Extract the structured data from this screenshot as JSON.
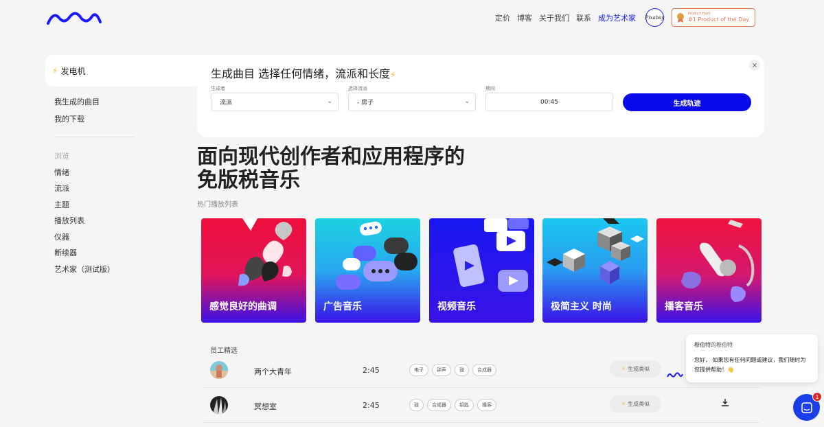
{
  "header": {
    "nav": [
      "定价",
      "博客",
      "关于我们",
      "联系",
      "成为艺术家"
    ],
    "badge_circle_text": "Pixabay",
    "product_hunt": {
      "small": "Product Hunt",
      "big": "#1 Product of the Day"
    }
  },
  "sidebar": {
    "generator_tab": "发电机",
    "links": [
      "我生成的曲目",
      "我的下载"
    ],
    "browse_heading": "浏览",
    "browse_items": [
      "情绪",
      "流派",
      "主题",
      "播放列表",
      "仪器",
      "断续器",
      "艺术家（测试版）"
    ]
  },
  "generator": {
    "title": "生成曲目 选择任何情绪，流派和长度",
    "close": "×",
    "genre_label": "生成者",
    "genre_value": "流派",
    "subgenre_label": "选择流派",
    "subgenre_value": "- 房子",
    "duration_label": "期间",
    "duration_value": "00:45",
    "button": "生成轨迹"
  },
  "hero": {
    "line1": "面向现代创作者和应用程序的",
    "line2": "免版税音乐",
    "playlist_heading": "热门播放列表"
  },
  "playlists": [
    {
      "label": "感觉良好的曲调"
    },
    {
      "label": "广告音乐"
    },
    {
      "label": "视频音乐"
    },
    {
      "label": "极简主义 时尚"
    },
    {
      "label": "播客音乐"
    }
  ],
  "staff": {
    "heading": "员工精选",
    "rows": [
      {
        "name": "两个大青年",
        "duration": "2:45",
        "tags": [
          "电子",
          "钟声",
          "鼓",
          "合成器"
        ],
        "similar": "生成类似"
      },
      {
        "name": "冥想室",
        "duration": "2:45",
        "tags": [
          "鼓",
          "合成器",
          "钥匙",
          "播客"
        ],
        "similar": "生成类似"
      }
    ]
  },
  "chat": {
    "sender_name": "穆伯特",
    "sender_suffix": "的穆伯特",
    "message": "您好， 如果您有任何问题或建议，我们随时为您提供帮助！👋"
  },
  "launcher_badge": "1",
  "colors": {
    "accent": "#0a0ae8",
    "bolt": "#f5b91a"
  }
}
